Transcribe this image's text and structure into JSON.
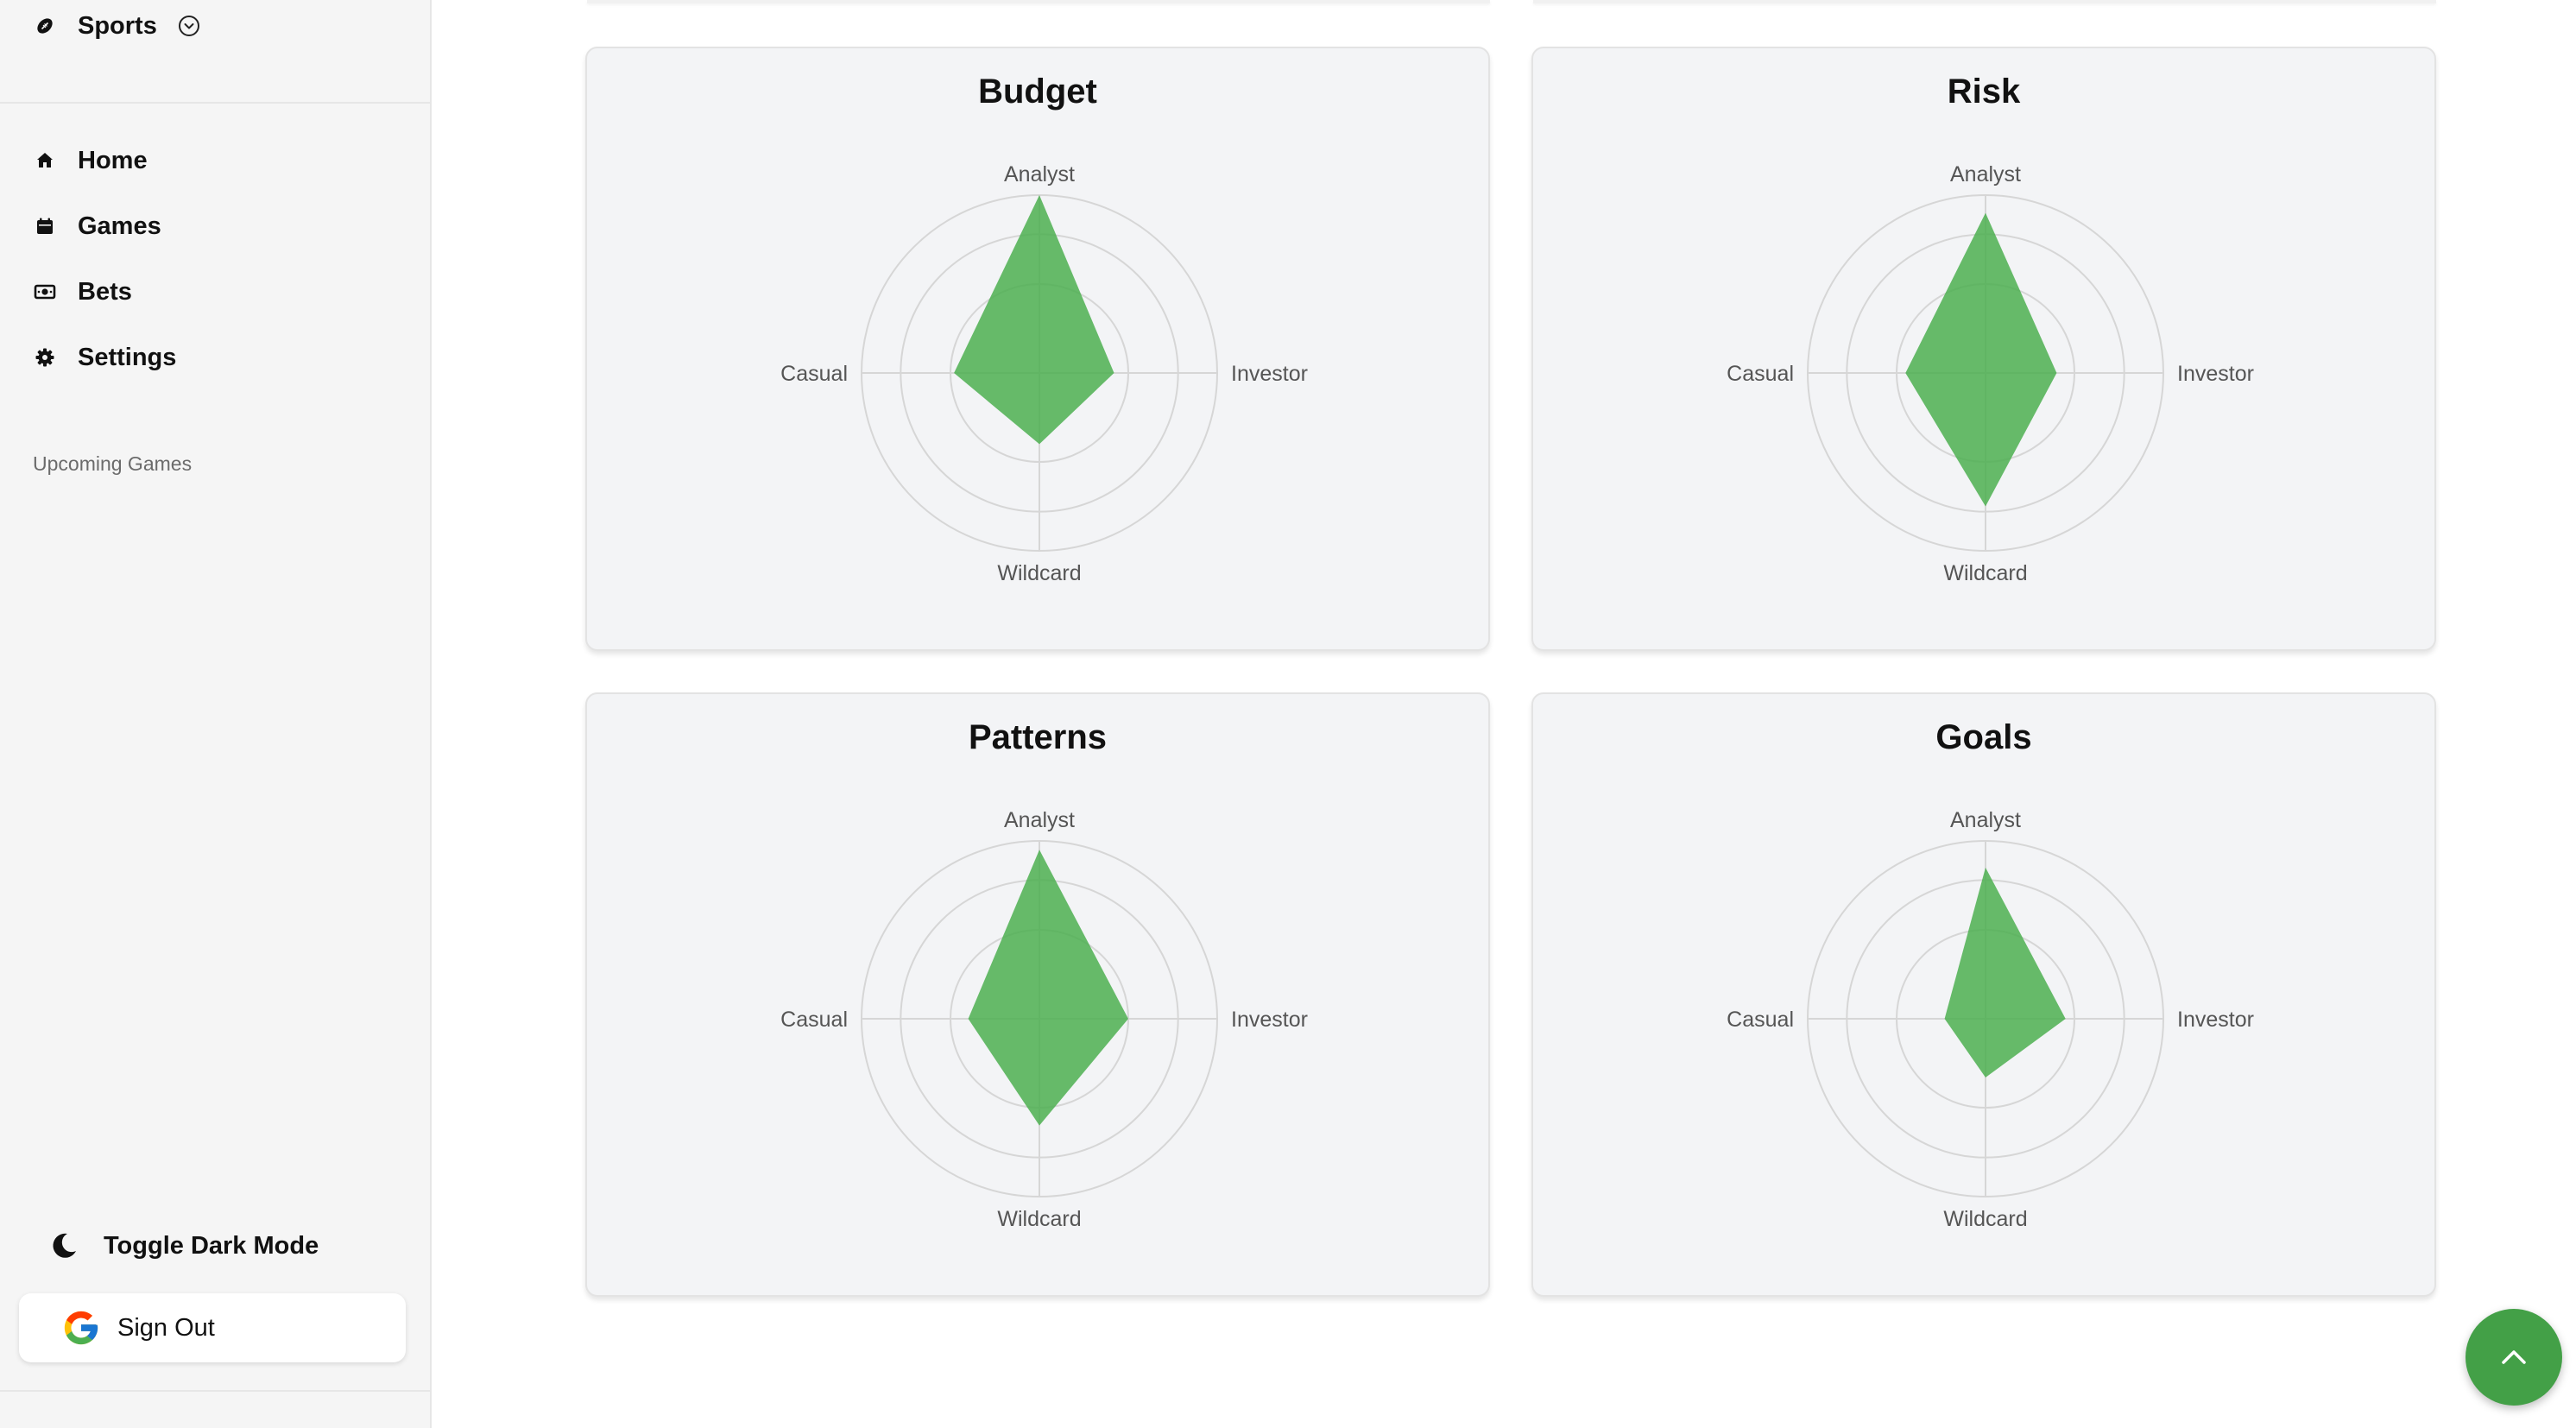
{
  "sidebar": {
    "sport": {
      "label": "Sports",
      "icon": "football-icon"
    },
    "nav": [
      {
        "label": "Home",
        "icon": "home-icon"
      },
      {
        "label": "Games",
        "icon": "calendar-icon"
      },
      {
        "label": "Bets",
        "icon": "money-icon"
      },
      {
        "label": "Settings",
        "icon": "gear-icon"
      }
    ],
    "section_label": "Upcoming Games",
    "dark_mode_label": "Toggle Dark Mode",
    "sign_out_label": "Sign Out"
  },
  "theme": {
    "accent": "#43a047",
    "radar_fill": "#4caf50"
  },
  "chart_data": [
    {
      "type": "radar",
      "title": "Budget",
      "axes": [
        "Analyst",
        "Investor",
        "Wildcard",
        "Casual"
      ],
      "rmax": 100,
      "values": [
        100,
        42,
        40,
        48
      ]
    },
    {
      "type": "radar",
      "title": "Risk",
      "axes": [
        "Analyst",
        "Investor",
        "Wildcard",
        "Casual"
      ],
      "rmax": 100,
      "values": [
        90,
        40,
        75,
        45
      ]
    },
    {
      "type": "radar",
      "title": "Patterns",
      "axes": [
        "Analyst",
        "Investor",
        "Wildcard",
        "Casual"
      ],
      "rmax": 100,
      "values": [
        95,
        50,
        60,
        40
      ]
    },
    {
      "type": "radar",
      "title": "Goals",
      "axes": [
        "Analyst",
        "Investor",
        "Wildcard",
        "Casual"
      ],
      "rmax": 100,
      "values": [
        85,
        45,
        33,
        23
      ]
    }
  ]
}
